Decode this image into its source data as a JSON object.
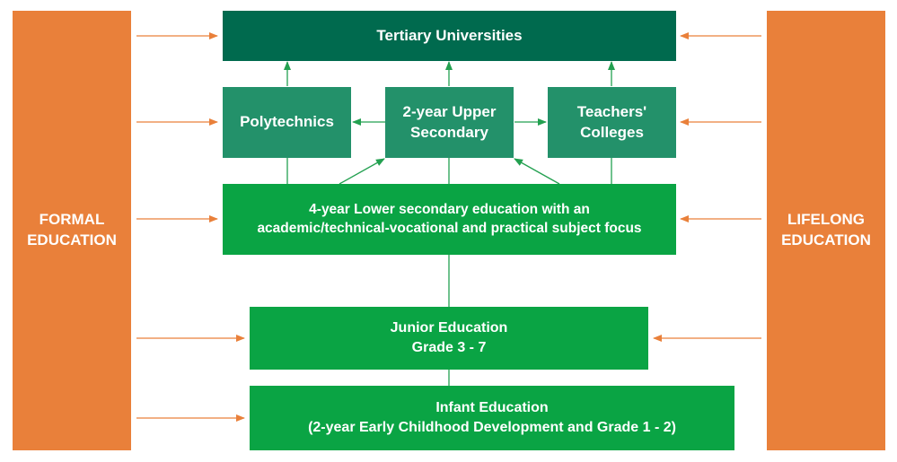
{
  "colors": {
    "side": "#e9803a",
    "tertiary": "#006a4e",
    "middle": "#23916a",
    "green": "#0aa444",
    "orange_line": "#e9803a",
    "green_line": "#23a050"
  },
  "side_left": {
    "label": "FORMAL\nEDUCATION"
  },
  "side_right": {
    "label": "LIFELONG\nEDUCATION"
  },
  "nodes": {
    "tertiary": {
      "label": "Tertiary Universities"
    },
    "polytechnics": {
      "label": "Polytechnics"
    },
    "upper_secondary": {
      "label": "2-year Upper\nSecondary"
    },
    "teachers_colleges": {
      "label": "Teachers'\nColleges"
    },
    "lower_secondary": {
      "label": "4-year Lower secondary education with an\nacademic/technical-vocational and practical subject focus"
    },
    "junior": {
      "label": "Junior Education\nGrade 3 - 7"
    },
    "infant": {
      "label": "Infant Education\n(2-year Early Childhood Development and Grade 1 - 2)"
    }
  }
}
